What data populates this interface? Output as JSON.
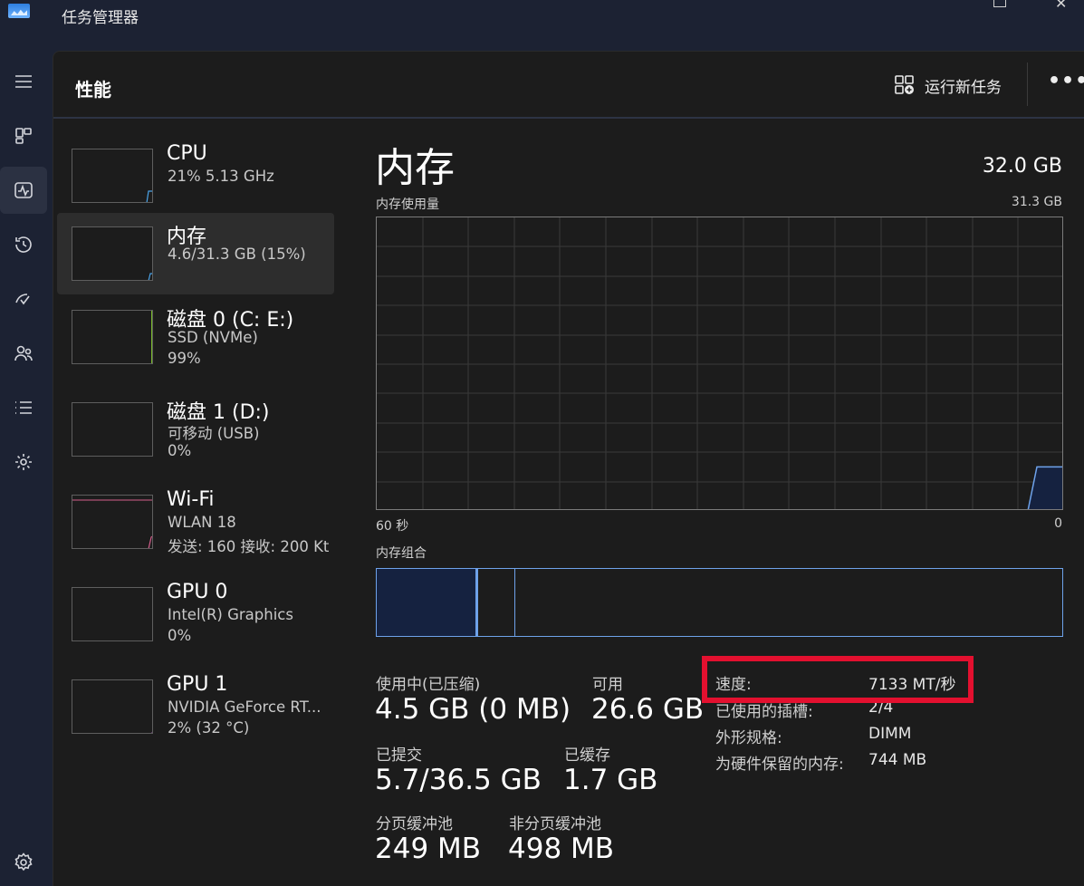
{
  "window": {
    "title": "任务管理器"
  },
  "nav": {
    "items": [
      {
        "icon": "hamburger-menu-icon"
      },
      {
        "icon": "processes-icon"
      },
      {
        "icon": "performance-icon",
        "active": true
      },
      {
        "icon": "app-history-icon"
      },
      {
        "icon": "startup-apps-icon"
      },
      {
        "icon": "users-icon"
      },
      {
        "icon": "details-icon"
      },
      {
        "icon": "services-icon"
      },
      {
        "icon": "settings-icon"
      }
    ]
  },
  "header": {
    "page_title": "性能",
    "run_task_label": "运行新任务",
    "more_label": "•••"
  },
  "sidebar": {
    "items": [
      {
        "name": "CPU",
        "line1": "21%  5.13 GHz",
        "line2": ""
      },
      {
        "name": "内存",
        "line1": "4.6/31.3 GB (15%)",
        "line2": "",
        "selected": true
      },
      {
        "name": "磁盘 0 (C: E:)",
        "line1": "SSD (NVMe)",
        "line2": "99%"
      },
      {
        "name": "磁盘 1 (D:)",
        "line1": "可移动 (USB)",
        "line2": "0%"
      },
      {
        "name": "Wi-Fi",
        "line1": "WLAN 18",
        "line2": "发送: 160  接收: 200 Kt"
      },
      {
        "name": "GPU 0",
        "line1": "Intel(R) Graphics",
        "line2": "0%"
      },
      {
        "name": "GPU 1",
        "line1": "NVIDIA GeForce RT...",
        "line2": "2%  (32 °C)"
      }
    ]
  },
  "memory": {
    "heading": "内存",
    "total": "32.0 GB",
    "usage_label": "内存使用量",
    "usage_max": "31.3 GB",
    "axis_left": "60 秒",
    "axis_right": "0",
    "composition_label": "内存组合",
    "stats": {
      "in_use_label": "使用中(已压缩)",
      "in_use_value": "4.5 GB (0 MB)",
      "available_label": "可用",
      "available_value": "26.6 GB",
      "committed_label": "已提交",
      "committed_value": "5.7/36.5 GB",
      "cached_label": "已缓存",
      "cached_value": "1.7 GB",
      "paged_label": "分页缓冲池",
      "paged_value": "249 MB",
      "nonpaged_label": "非分页缓冲池",
      "nonpaged_value": "498 MB"
    },
    "details": {
      "speed_label": "速度:",
      "speed_value": "7133 MT/秒",
      "slots_label": "已使用的插槽:",
      "slots_value": "2/4",
      "form_label": "外形规格:",
      "form_value": "DIMM",
      "reserved_label": "为硬件保留的内存:",
      "reserved_value": "744 MB"
    },
    "usage_fraction": 0.15
  },
  "colors": {
    "accent": "#6ea2ea",
    "highlight": "#e3102f",
    "disk_line": "#78b82a",
    "wifi_line": "#d35e8c"
  }
}
